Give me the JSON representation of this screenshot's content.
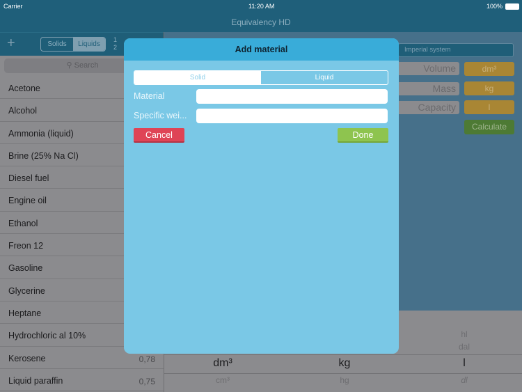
{
  "status_bar": {
    "carrier": "Carrier",
    "time": "11:20 AM",
    "battery": "100%"
  },
  "app_title": "Equivalency HD",
  "toolbar": {
    "add_icon": "plus-icon",
    "segments": [
      "Solids",
      "Liquids"
    ],
    "selected": "Liquids",
    "sort_label_top": "1",
    "sort_label_bottom": "2"
  },
  "search": {
    "placeholder": "Search"
  },
  "materials": [
    {
      "name": "Acetone",
      "value": ""
    },
    {
      "name": "Alcohol",
      "value": ""
    },
    {
      "name": "Ammonia (liquid)",
      "value": ""
    },
    {
      "name": "Brine (25% Na Cl)",
      "value": ""
    },
    {
      "name": "Diesel fuel",
      "value": ""
    },
    {
      "name": "Engine oil",
      "value": ""
    },
    {
      "name": "Ethanol",
      "value": ""
    },
    {
      "name": "Freon 12",
      "value": ""
    },
    {
      "name": "Gasoline",
      "value": ""
    },
    {
      "name": "Glycerine",
      "value": ""
    },
    {
      "name": "Heptane",
      "value": ""
    },
    {
      "name": "Hydrochloric al 10%",
      "value": ""
    },
    {
      "name": "Kerosene",
      "value": "0,78"
    },
    {
      "name": "Liquid paraffin",
      "value": "0,75"
    }
  ],
  "calculator": {
    "system": "Imperial system",
    "volume_label": "Volume",
    "volume_unit": "dm³",
    "mass_label": "Mass",
    "mass_unit": "kg",
    "capacity_label": "Capacity",
    "capacity_unit": "l",
    "calculate": "Calculate"
  },
  "picker": {
    "col1": [
      "",
      "",
      "dm³",
      "cm³"
    ],
    "col2": [
      "",
      "",
      "kg",
      "hg"
    ],
    "col3": [
      "hl",
      "dal",
      "l",
      "dl"
    ]
  },
  "modal": {
    "title": "Add material",
    "segments": [
      "Solid",
      "Liquid"
    ],
    "selected": "Solid",
    "material_label": "Material",
    "material_value": "",
    "weight_label": "Specific wei...",
    "weight_value": "",
    "cancel": "Cancel",
    "done": "Done"
  },
  "colors": {
    "modal_bg": "#7ac8e6",
    "modal_header": "#39acd9",
    "cancel": "#df4456",
    "done": "#8ec44f",
    "unit": "#a98634",
    "calculate": "#4d7a34"
  }
}
